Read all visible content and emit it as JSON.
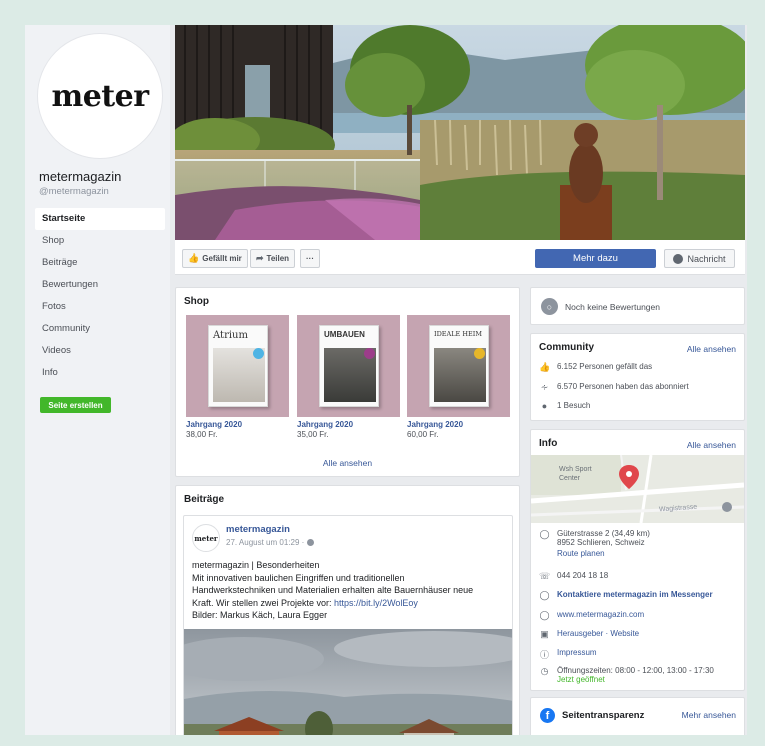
{
  "profile": {
    "logo_text": "meter",
    "name": "metermagazin",
    "handle": "@metermagazin"
  },
  "nav": {
    "items": [
      {
        "label": "Startseite"
      },
      {
        "label": "Shop"
      },
      {
        "label": "Beiträge"
      },
      {
        "label": "Bewertungen"
      },
      {
        "label": "Fotos"
      },
      {
        "label": "Community"
      },
      {
        "label": "Videos"
      },
      {
        "label": "Info"
      }
    ],
    "create_button": "Seite erstellen"
  },
  "actions": {
    "like": "Gefällt mir",
    "share": "Teilen",
    "more": "···",
    "learn_more": "Mehr dazu",
    "message": "Nachricht"
  },
  "shop": {
    "title": "Shop",
    "products": [
      {
        "cover_title": "Atrium",
        "name": "Jahrgang 2020",
        "price": "38,00 Fr."
      },
      {
        "cover_title": "UMBAUEN",
        "name": "Jahrgang 2020",
        "price": "35,00 Fr."
      },
      {
        "cover_title": "IDEALE HEIM",
        "name": "Jahrgang 2020",
        "price": "60,00 Fr."
      }
    ],
    "see_all": "Alle ansehen"
  },
  "posts": {
    "title": "Beiträge",
    "post": {
      "avatar_text": "meter",
      "author": "metermagazin",
      "time": "27. August um 01:29 ·",
      "lines": [
        "metermagazin | Besonderheiten",
        "Mit innovativen baulichen Eingriffen und traditionellen",
        "Handwerkstechniken und Materialien erhalten alte Bauernhäuser neue",
        "Bilder: Markus Käch, Laura Egger"
      ],
      "line3_prefix": "Kraft. Wir stellen zwei Projekte vor: ",
      "link": "https://bit.ly/2WolEoy"
    }
  },
  "reviews": {
    "text": "Noch keine Bewertungen"
  },
  "community": {
    "title": "Community",
    "see_all": "Alle ansehen",
    "likes": "6.152 Personen gefällt das",
    "followers": "6.570 Personen haben das abonniert",
    "visits": "1 Besuch"
  },
  "info": {
    "title": "Info",
    "see_all": "Alle ansehen",
    "map_label": "Wsh Sport Center",
    "map_street": "Wagistrasse",
    "address_line1": "Güterstrasse 2 (34,49 km)",
    "address_line2": "8952 Schlieren, Schweiz",
    "route": "Route planen",
    "phone": "044 204 18 18",
    "messenger": "Kontaktiere metermagazin im Messenger",
    "website": "www.metermagazin.com",
    "category": "Herausgeber · Website",
    "impressum": "Impressum",
    "hours": "Öffnungszeiten: 08:00 - 12:00, 13:00 - 17:30",
    "open_now": "Jetzt geöffnet"
  },
  "transparency": {
    "title": "Seitentransparenz",
    "see_more": "Mehr ansehen"
  },
  "colors": {
    "brand_blue": "#4267b2",
    "link_blue": "#385898",
    "green": "#42b72a",
    "background_mint": "#dcebe6"
  }
}
